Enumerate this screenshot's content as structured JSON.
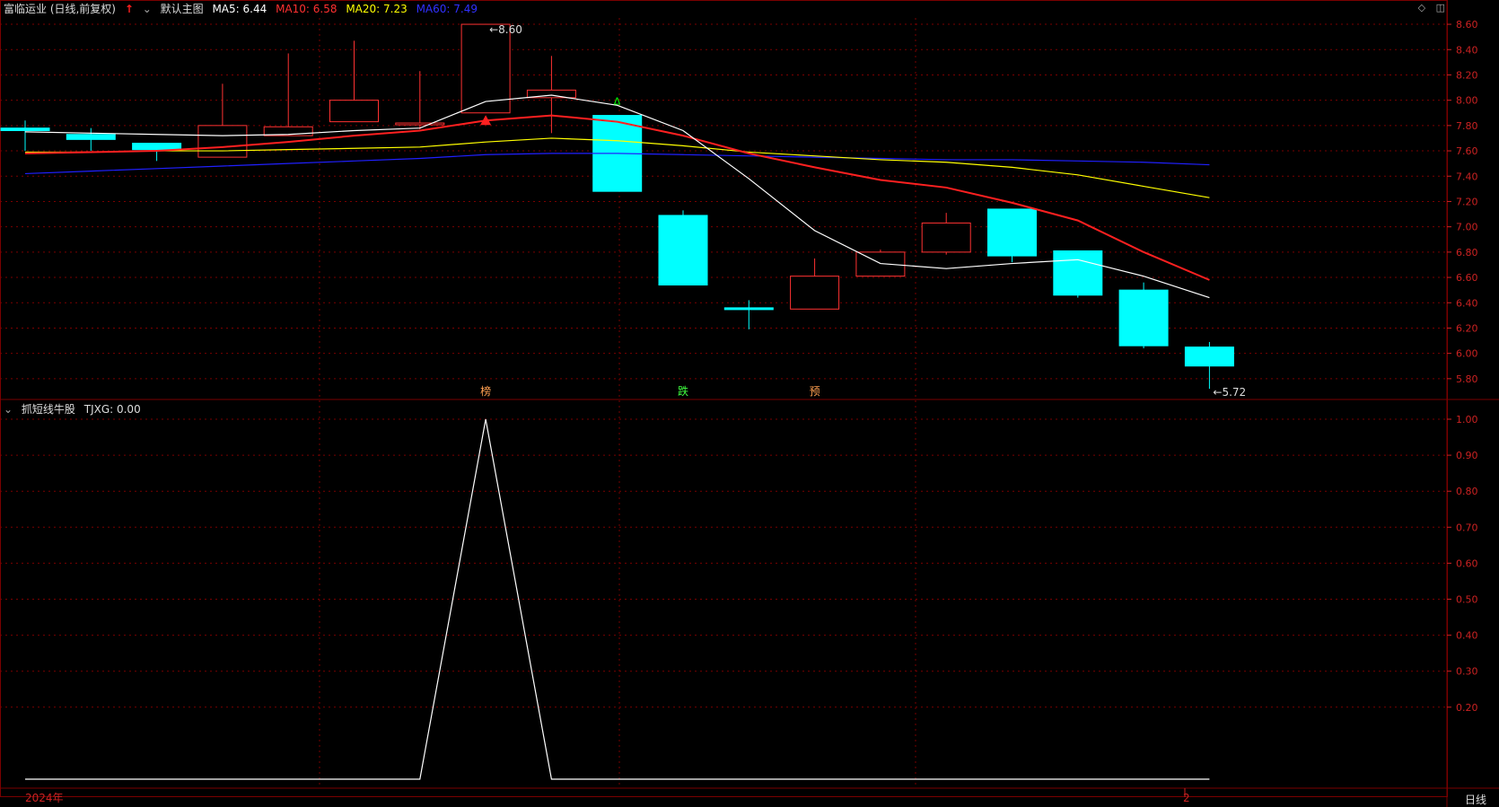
{
  "header": {
    "symbol": "富临运业 (日线,前复权)",
    "up_arrow": "↑",
    "main_chart": "默认主图",
    "ma5": "MA5: 6.44",
    "ma10": "MA10: 6.58",
    "ma20": "MA20: 7.23",
    "ma60": "MA60: 7.49"
  },
  "indicator_header": {
    "name": "抓短线牛股",
    "value": "TJXG: 0.00"
  },
  "corner_icons": [
    "diamond-icon",
    "panel-toggle-icon"
  ],
  "period": "日线",
  "year_label": "2024年",
  "month_label": "2",
  "colors": {
    "up": "#ff3232",
    "down": "#00ffff",
    "ma5": "#ffffff",
    "ma10": "#ff2020",
    "ma20": "#ffff00",
    "ma60": "#2020ff",
    "grid": "#7a0000",
    "axis": "#cc2222"
  },
  "chart_data": [
    {
      "type": "candlestick",
      "ylim": [
        5.65,
        8.65
      ],
      "yticks": [
        "8.60",
        "8.40",
        "8.20",
        "8.00",
        "7.80",
        "7.60",
        "7.40",
        "7.20",
        "7.00",
        "6.80",
        "6.60",
        "6.40",
        "6.20",
        "6.00",
        "5.80"
      ],
      "candles": [
        {
          "o": 7.78,
          "c": 7.76,
          "h": 7.84,
          "l": 7.6
        },
        {
          "o": 7.73,
          "c": 7.69,
          "h": 7.78,
          "l": 7.6
        },
        {
          "o": 7.66,
          "c": 7.61,
          "h": 7.66,
          "l": 7.52
        },
        {
          "o": 7.55,
          "c": 7.8,
          "h": 8.13,
          "l": 7.55
        },
        {
          "o": 7.72,
          "c": 7.79,
          "h": 8.37,
          "l": 7.72
        },
        {
          "o": 7.83,
          "c": 8.0,
          "h": 8.47,
          "l": 7.83
        },
        {
          "o": 7.82,
          "c": 7.82,
          "h": 8.23,
          "l": 7.77
        },
        {
          "o": 7.9,
          "c": 8.6,
          "h": 8.6,
          "l": 7.9
        },
        {
          "o": 8.02,
          "c": 8.08,
          "h": 8.35,
          "l": 7.74
        },
        {
          "o": 7.88,
          "c": 7.28,
          "h": 7.88,
          "l": 7.28
        },
        {
          "o": 7.09,
          "c": 6.54,
          "h": 7.13,
          "l": 6.54
        },
        {
          "o": 6.36,
          "c": 6.35,
          "h": 6.42,
          "l": 6.19
        },
        {
          "o": 6.35,
          "c": 6.61,
          "h": 6.75,
          "l": 6.35
        },
        {
          "o": 6.61,
          "c": 6.8,
          "h": 6.82,
          "l": 6.61
        },
        {
          "o": 6.8,
          "c": 7.03,
          "h": 7.11,
          "l": 6.78
        },
        {
          "o": 7.14,
          "c": 6.77,
          "h": 7.14,
          "l": 6.72
        },
        {
          "o": 6.81,
          "c": 6.46,
          "h": 6.81,
          "l": 6.44
        },
        {
          "o": 6.5,
          "c": 6.06,
          "h": 6.56,
          "l": 6.04
        },
        {
          "o": 6.05,
          "c": 5.9,
          "h": 6.09,
          "l": 5.72
        }
      ],
      "ma5": [
        7.75,
        7.74,
        7.73,
        7.72,
        7.73,
        7.76,
        7.78,
        7.99,
        8.04,
        7.96,
        7.76,
        7.38,
        6.97,
        6.71,
        6.67,
        6.71,
        6.74,
        6.61,
        6.44
      ],
      "ma10": [
        7.58,
        7.59,
        7.6,
        7.63,
        7.67,
        7.72,
        7.76,
        7.84,
        7.88,
        7.83,
        7.72,
        7.58,
        7.47,
        7.37,
        7.31,
        7.19,
        7.05,
        6.8,
        6.58
      ],
      "ma20": [
        7.59,
        7.59,
        7.6,
        7.6,
        7.61,
        7.62,
        7.63,
        7.67,
        7.7,
        7.68,
        7.64,
        7.59,
        7.56,
        7.53,
        7.51,
        7.47,
        7.41,
        7.32,
        7.23
      ],
      "ma60": [
        7.42,
        7.44,
        7.46,
        7.48,
        7.5,
        7.52,
        7.54,
        7.57,
        7.58,
        7.58,
        7.57,
        7.56,
        7.55,
        7.54,
        7.53,
        7.53,
        7.52,
        7.51,
        7.49
      ],
      "annotations": [
        {
          "text": "8.60",
          "index": 7,
          "value": 8.6
        },
        {
          "text": "5.72",
          "index": 18,
          "value": 5.72
        }
      ],
      "markers": [
        {
          "text": "榜",
          "index": 7
        },
        {
          "text": "跌",
          "index": 10
        },
        {
          "text": "预",
          "index": 12
        }
      ]
    },
    {
      "type": "line",
      "name": "TJXG",
      "ylim": [
        0,
        1.0
      ],
      "yticks": [
        "1.00",
        "0.90",
        "0.80",
        "0.70",
        "0.60",
        "0.50",
        "0.40",
        "0.30",
        "0.20"
      ],
      "values": [
        0,
        0,
        0,
        0,
        0,
        0,
        0,
        1,
        0,
        0,
        0,
        0,
        0,
        0,
        0,
        0,
        0,
        0,
        0
      ]
    }
  ]
}
